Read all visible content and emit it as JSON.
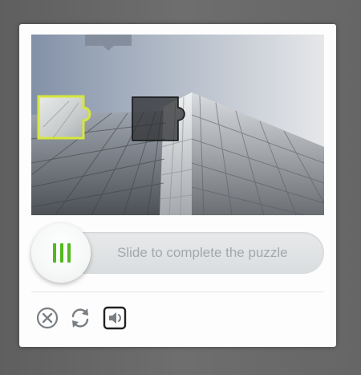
{
  "captcha": {
    "slider_prompt": "Slide to complete the puzzle"
  },
  "icons": {
    "close": "close-circle-icon",
    "refresh": "refresh-icon",
    "audio": "speaker-icon",
    "grip": "grip-lines-icon"
  },
  "colors": {
    "accent": "#54b81f",
    "piece_border": "#d6e63c",
    "icon": "#7a7f84",
    "slider_text": "#a3a8ad"
  }
}
